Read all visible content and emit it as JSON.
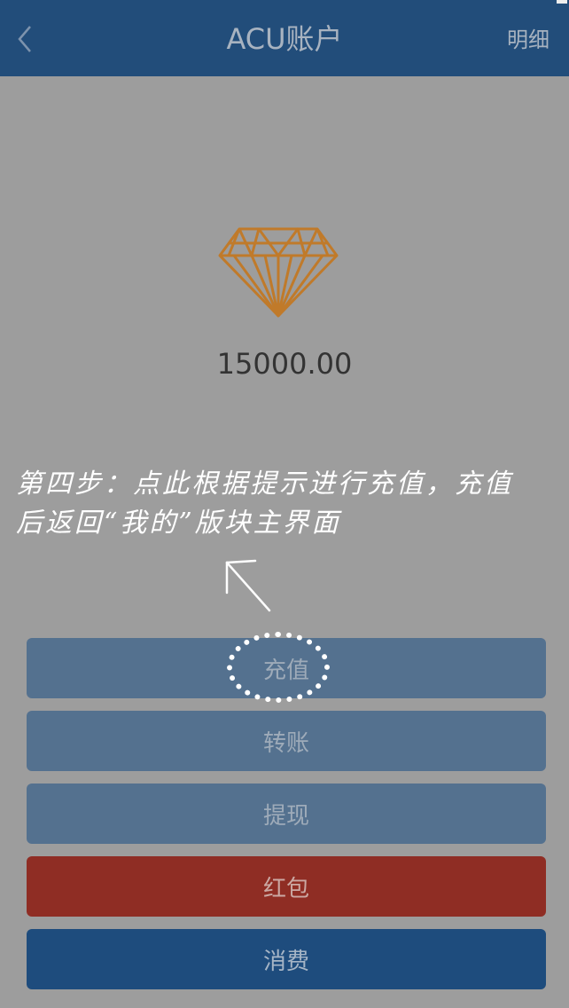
{
  "header": {
    "title": "ACU账户",
    "detail_label": "明细"
  },
  "account": {
    "balance": "15000.00"
  },
  "hint": {
    "line1": "第四步：点此根据提示进行充值，充值",
    "line2": "后返回“我的”版块主界面"
  },
  "actions": {
    "recharge": "充值",
    "transfer": "转账",
    "withdraw": "提现",
    "red_packet": "红包",
    "consume": "消费"
  },
  "colors": {
    "header_bg": "#224d7a",
    "diamond": "#c07a2a",
    "red_packet_button": "#8f2d24",
    "consume_button": "#1e4c7d"
  },
  "icons": {
    "back": "chevron-left-icon",
    "diamond": "diamond-icon",
    "hint_arrow": "arrow-up-left-icon"
  }
}
